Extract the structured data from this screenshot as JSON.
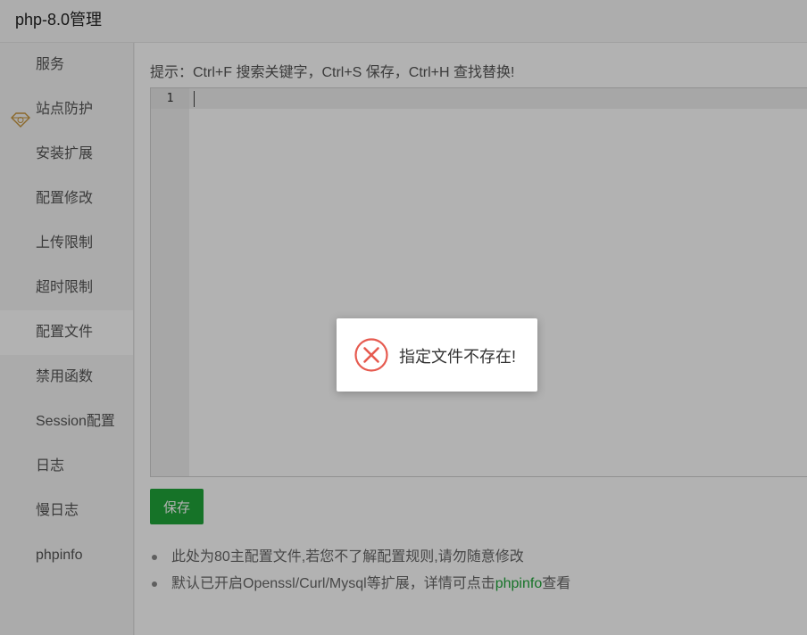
{
  "window": {
    "title": "php-8.0管理"
  },
  "sidebar": {
    "items": [
      {
        "label": "服务"
      },
      {
        "label": "站点防护",
        "icon": "diamond-icon"
      },
      {
        "label": "安装扩展"
      },
      {
        "label": "配置修改"
      },
      {
        "label": "上传限制"
      },
      {
        "label": "超时限制"
      },
      {
        "label": "配置文件",
        "active": true
      },
      {
        "label": "禁用函数"
      },
      {
        "label": "Session配置"
      },
      {
        "label": "日志"
      },
      {
        "label": "慢日志"
      },
      {
        "label": "phpinfo"
      }
    ]
  },
  "main": {
    "hint": "提示：Ctrl+F 搜索关键字，Ctrl+S 保存，Ctrl+H 查找替换!",
    "editor": {
      "line_number": "1",
      "content": ""
    },
    "save_label": "保存",
    "notes": [
      {
        "text": "此处为80主配置文件,若您不了解配置规则,请勿随意修改"
      },
      {
        "text_before": "默认已开启Openssl/Curl/Mysql等扩展，详情可点击",
        "link": "phpinfo",
        "text_after": "查看"
      }
    ]
  },
  "toast": {
    "message": "指定文件不存在!",
    "icon": "error-icon"
  },
  "colors": {
    "accent": "#20a53a",
    "error": "#e65a4f",
    "diamond": "#c8963c"
  }
}
